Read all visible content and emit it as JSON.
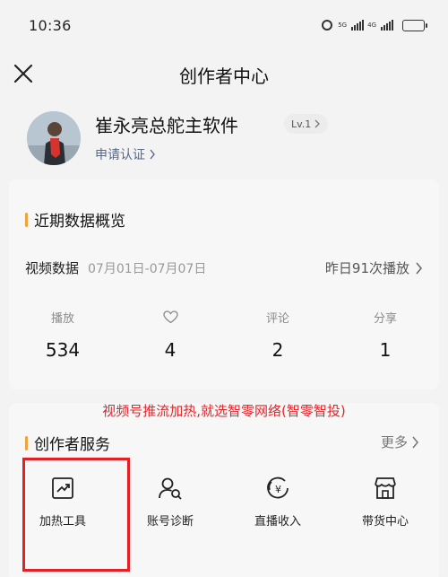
{
  "status_bar": {
    "time": "10:36",
    "signal1_label": "5G",
    "signal2_label": "4G",
    "battery_level": 0.45
  },
  "nav": {
    "title": "创作者中心"
  },
  "profile": {
    "name": "崔永亮总舵主软件",
    "level": "Lv.1",
    "certify_label": "申请认证"
  },
  "overview": {
    "title": "近期数据概览",
    "video_label": "视频数据",
    "date_range": "07月01日-07月07日",
    "yesterday_plays": "昨日91次播放",
    "stats": [
      {
        "label": "播放",
        "value": "534"
      },
      {
        "label": "",
        "value": "4",
        "icon": "heart-icon"
      },
      {
        "label": "评论",
        "value": "2"
      },
      {
        "label": "分享",
        "value": "1"
      }
    ]
  },
  "promo_text": "视频号推流加热,就选智零网络(智零智投)",
  "services": {
    "title": "创作者服务",
    "more_label": "更多",
    "items": [
      {
        "label": "加热工具",
        "icon": "trend-chart-icon"
      },
      {
        "label": "账号诊断",
        "icon": "user-search-icon"
      },
      {
        "label": "直播收入",
        "icon": "live-income-icon"
      },
      {
        "label": "带货中心",
        "icon": "shop-icon"
      }
    ]
  },
  "colors": {
    "accent_bar": "#f0a33c",
    "promo_red": "#e0262b",
    "highlight_red": "#e51f23",
    "link_blue": "#57688c"
  }
}
